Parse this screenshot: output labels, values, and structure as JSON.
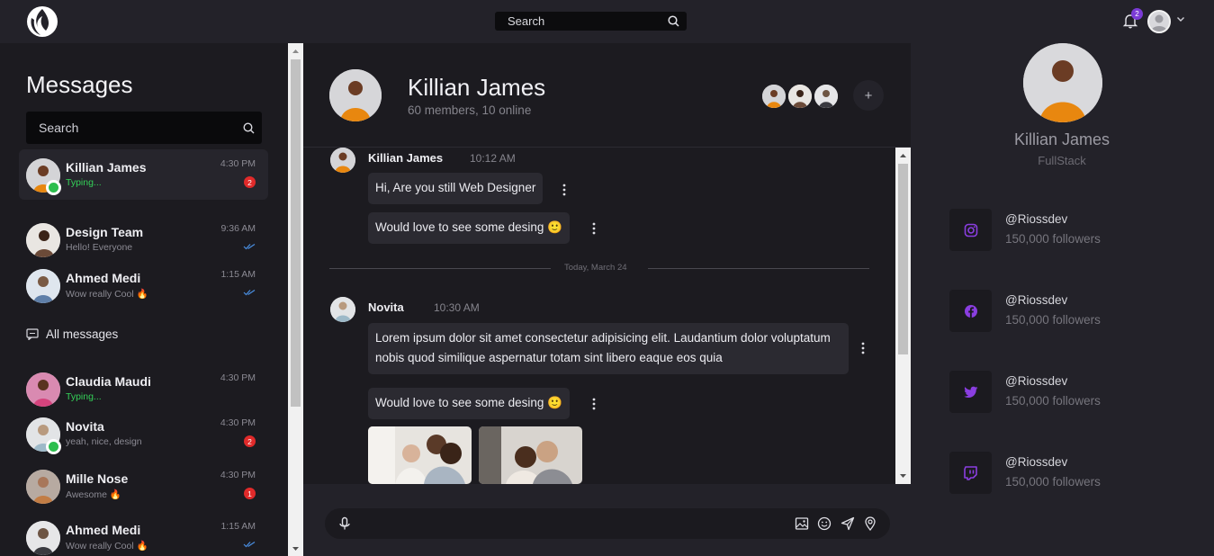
{
  "topbar": {
    "search_placeholder": "Search",
    "notification_count": "2"
  },
  "sidebar": {
    "title": "Messages",
    "search_placeholder": "Search",
    "all_messages_label": "All messages",
    "conversations": [
      {
        "name": "Killian James",
        "sub": "Typing...",
        "time": "4:30 PM",
        "badge": "2"
      },
      {
        "name": "Design Team",
        "sub": "Hello! Everyone",
        "time": "9:36 AM"
      },
      {
        "name": "Ahmed Medi",
        "sub": "Wow really Cool 🔥",
        "time": "1:15 AM"
      },
      {
        "name": "Claudia Maudi",
        "sub": "Typing...",
        "time": "4:30 PM"
      },
      {
        "name": "Novita",
        "sub": "yeah, nice, design",
        "time": "4:30 PM",
        "badge": "2"
      },
      {
        "name": "Mille Nose",
        "sub": "Awesome 🔥",
        "time": "4:30 PM",
        "badge": "1"
      },
      {
        "name": "Ahmed Medi",
        "sub": "Wow really Cool 🔥",
        "time": "1:15 AM"
      }
    ]
  },
  "chat": {
    "title": "Killian James",
    "subtitle": "60 members, 10 online",
    "add_label": "+",
    "messages": [
      {
        "author": "Killian James",
        "time": "10:12 AM",
        "texts": [
          "Hi, Are you still Web Designer",
          "Would love to see some desing 🙂"
        ]
      },
      {
        "author": "Novita",
        "time": "10:30 AM",
        "texts": [
          "Lorem ipsum dolor sit amet consectetur adipisicing elit. Laudantium dolor voluptatum nobis quod similique aspernatur totam sint libero eaque eos quia",
          "Would love to see some desing 🙂"
        ]
      }
    ],
    "divider_label": "Today, March 24"
  },
  "profile": {
    "name": "Killian James",
    "role": "FullStack",
    "socials": [
      {
        "icon": "instagram-icon",
        "handle": "@Riossdev",
        "followers": "150,000 followers"
      },
      {
        "icon": "facebook-icon",
        "handle": "@Riossdev",
        "followers": "150,000 followers"
      },
      {
        "icon": "twitter-icon",
        "handle": "@Riossdev",
        "followers": "150,000 followers"
      },
      {
        "icon": "twitch-icon",
        "handle": "@Riossdev",
        "followers": "150,000 followers"
      }
    ]
  },
  "colors": {
    "accent": "#8a3ee0",
    "online": "#2dbe4e",
    "badge": "#e02a2a",
    "typing": "#34d058"
  }
}
